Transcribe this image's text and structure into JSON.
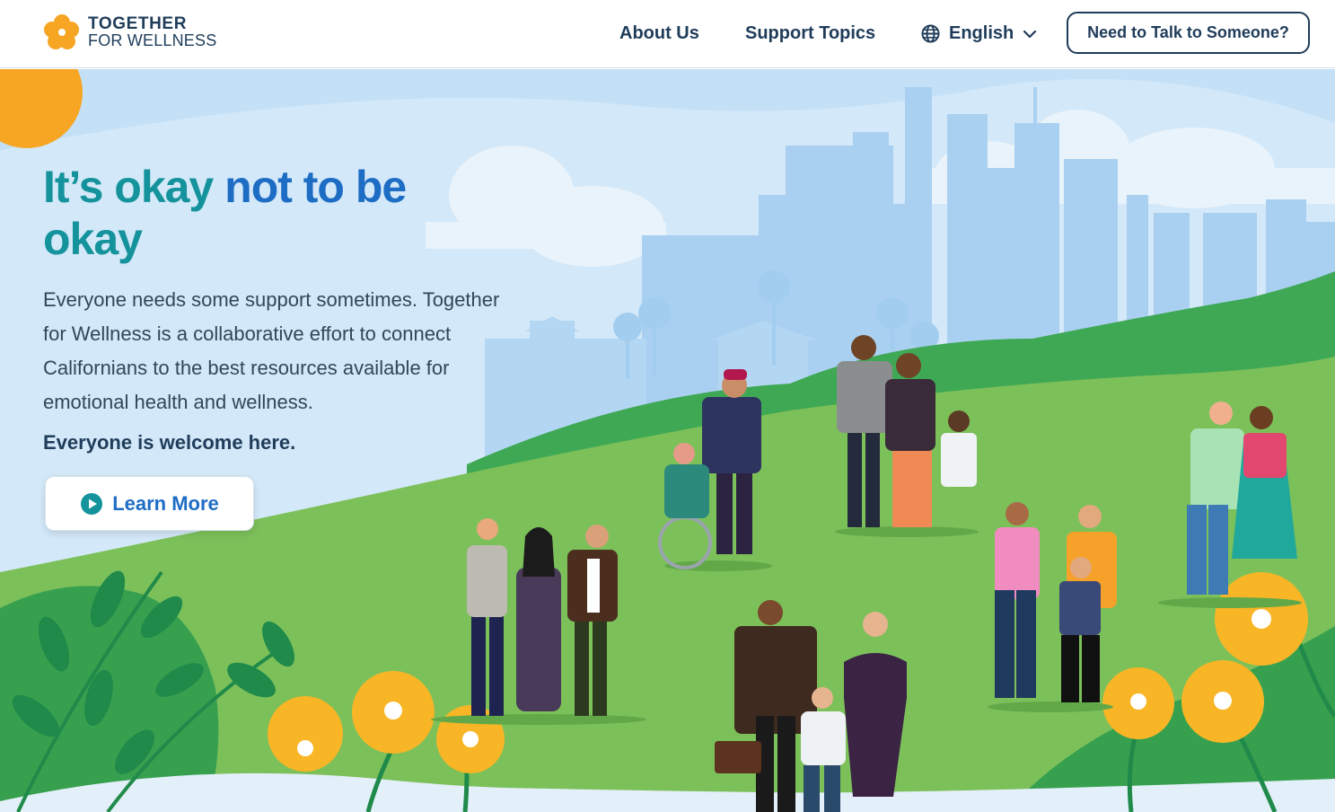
{
  "header": {
    "logo_line1": "TOGETHER",
    "logo_line2": "FOR WELLNESS",
    "nav": {
      "about": "About Us",
      "topics": "Support Topics",
      "language": "English"
    },
    "cta_label": "Need to Talk to Someone?"
  },
  "hero": {
    "title_part1": "It’s okay",
    "title_part2": "not to",
    "title_part3": "be",
    "title_part4": "okay",
    "body": "Everyone needs some support sometimes. Together for Wellness is a collaborative effort to connect Californians to the best resources available for emotional health and wellness.",
    "welcome": "Everyone is welcome here.",
    "learn_more": "Learn More"
  },
  "colors": {
    "navy": "#1f3c5a",
    "teal": "#14939c",
    "blue": "#1e6dc4",
    "sky": "#cfe6f7",
    "grass": "#7cc05a",
    "sun": "#f6a623",
    "poppy": "#f8b526"
  }
}
